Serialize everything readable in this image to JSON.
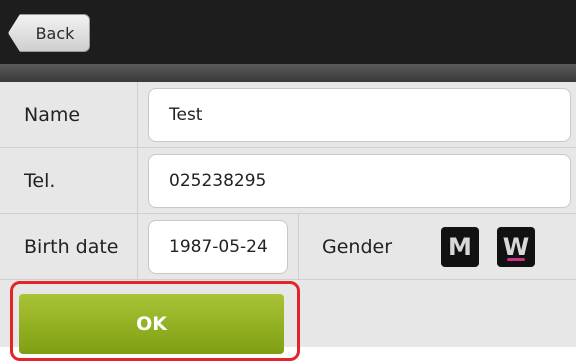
{
  "header": {
    "back_label": "Back"
  },
  "form": {
    "name": {
      "label": "Name",
      "value": "Test"
    },
    "tel": {
      "label": "Tel.",
      "value": "025238295"
    },
    "birth_date": {
      "label": "Birth date",
      "value": "1987-05-24"
    },
    "gender": {
      "label": "Gender",
      "male_label": "M",
      "female_label": "W",
      "selected": "W"
    }
  },
  "actions": {
    "ok_label": "OK"
  },
  "colors": {
    "ok_green": "#8fb11f",
    "selection_pink": "#d12f88",
    "highlight_red": "#e2252b"
  }
}
